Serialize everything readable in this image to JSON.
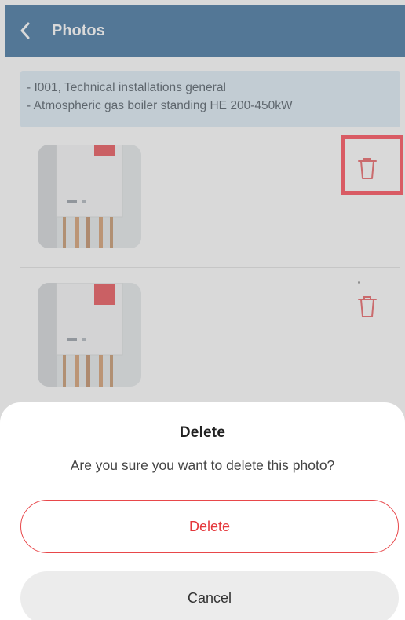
{
  "header": {
    "title": "Photos",
    "back_icon": "chevron-left-icon"
  },
  "info": {
    "lines": [
      "- I001, Technical installations general",
      "- Atmospheric gas boiler standing HE 200-450kW"
    ]
  },
  "photos": [
    {
      "delete_icon": "trash-icon"
    },
    {
      "delete_icon": "trash-icon"
    }
  ],
  "dialog": {
    "title": "Delete",
    "message": "Are you sure you want to delete this photo?",
    "confirm_label": "Delete",
    "cancel_label": "Cancel"
  },
  "colors": {
    "header_bg": "#0b4d85",
    "info_bg": "#d5e7f4",
    "delete_accent": "#e4373b",
    "highlight": "#ff1a2a"
  }
}
